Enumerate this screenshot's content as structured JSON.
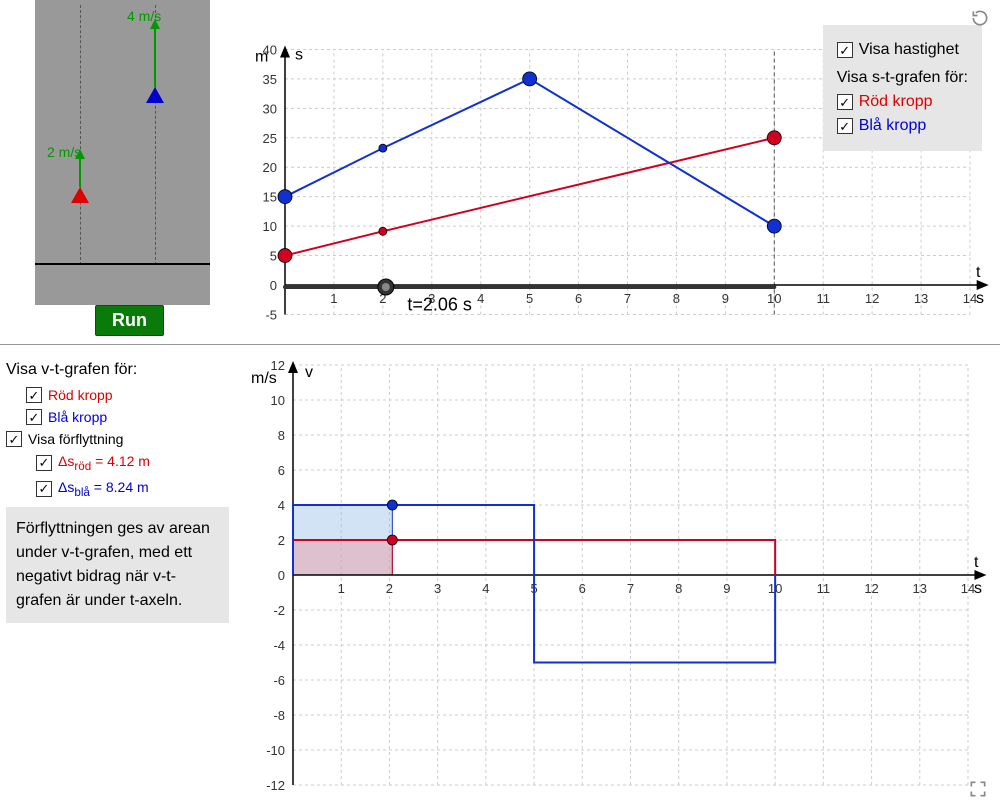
{
  "sim": {
    "red_vel_label": "2 m/s",
    "blue_vel_label": "4 m/s",
    "run_label": "Run"
  },
  "legend_top": {
    "show_velocity": "Visa hastighet",
    "st_title": "Visa s-t-grafen för:",
    "red": "Röd kropp",
    "blue": "Blå kropp"
  },
  "st_graph": {
    "y_axis_unit": "m",
    "y_axis_label": "s",
    "x_axis_unit": "t",
    "x_axis_sub": "s",
    "time_readout": "t=2.06 s"
  },
  "left_controls": {
    "vt_title": "Visa v-t-grafen för:",
    "red": "Röd kropp",
    "blue": "Blå kropp",
    "show_disp": "Visa förflyttning",
    "ds_red": "Δs",
    "ds_red_sub": "röd",
    "ds_red_val": " = 4.12 m",
    "ds_blue": "Δs",
    "ds_blue_sub": "blå",
    "ds_blue_val": " = 8.24 m",
    "info": "Förflyttningen ges av arean under v-t-grafen, med ett negativt bidrag när v-t-grafen är under t-axeln."
  },
  "vt_graph": {
    "y_axis_unit": "m/s",
    "y_axis_label": "v",
    "x_axis_unit": "t",
    "x_axis_sub": "s"
  },
  "chart_data": [
    {
      "type": "line",
      "name": "s-t graph",
      "xlabel": "t (s)",
      "ylabel": "s (m)",
      "xlim": [
        0,
        14
      ],
      "ylim": [
        -5,
        40
      ],
      "current_t": 2.06,
      "slider_range_t": 10,
      "series": [
        {
          "name": "Röd kropp",
          "color": "#d00020",
          "x": [
            0,
            2,
            10
          ],
          "y": [
            5,
            9.12,
            25
          ]
        },
        {
          "name": "Blå kropp",
          "color": "#1030d0",
          "x": [
            0,
            2,
            5,
            10
          ],
          "y": [
            15,
            23.24,
            35,
            10
          ]
        }
      ]
    },
    {
      "type": "line",
      "name": "v-t graph",
      "xlabel": "t (s)",
      "ylabel": "v (m/s)",
      "xlim": [
        0,
        14
      ],
      "ylim": [
        -12,
        12
      ],
      "current_t": 2.06,
      "series": [
        {
          "name": "Röd kropp",
          "color": "#d00020",
          "segments": [
            {
              "t0": 0,
              "t1": 10,
              "v": 2
            }
          ],
          "area_under_to_t": 4.12
        },
        {
          "name": "Blå kropp",
          "color": "#1030d0",
          "segments": [
            {
              "t0": 0,
              "t1": 5,
              "v": 4
            },
            {
              "t0": 5,
              "t1": 10,
              "v": -5
            }
          ],
          "area_under_to_t": 8.24
        }
      ]
    }
  ]
}
